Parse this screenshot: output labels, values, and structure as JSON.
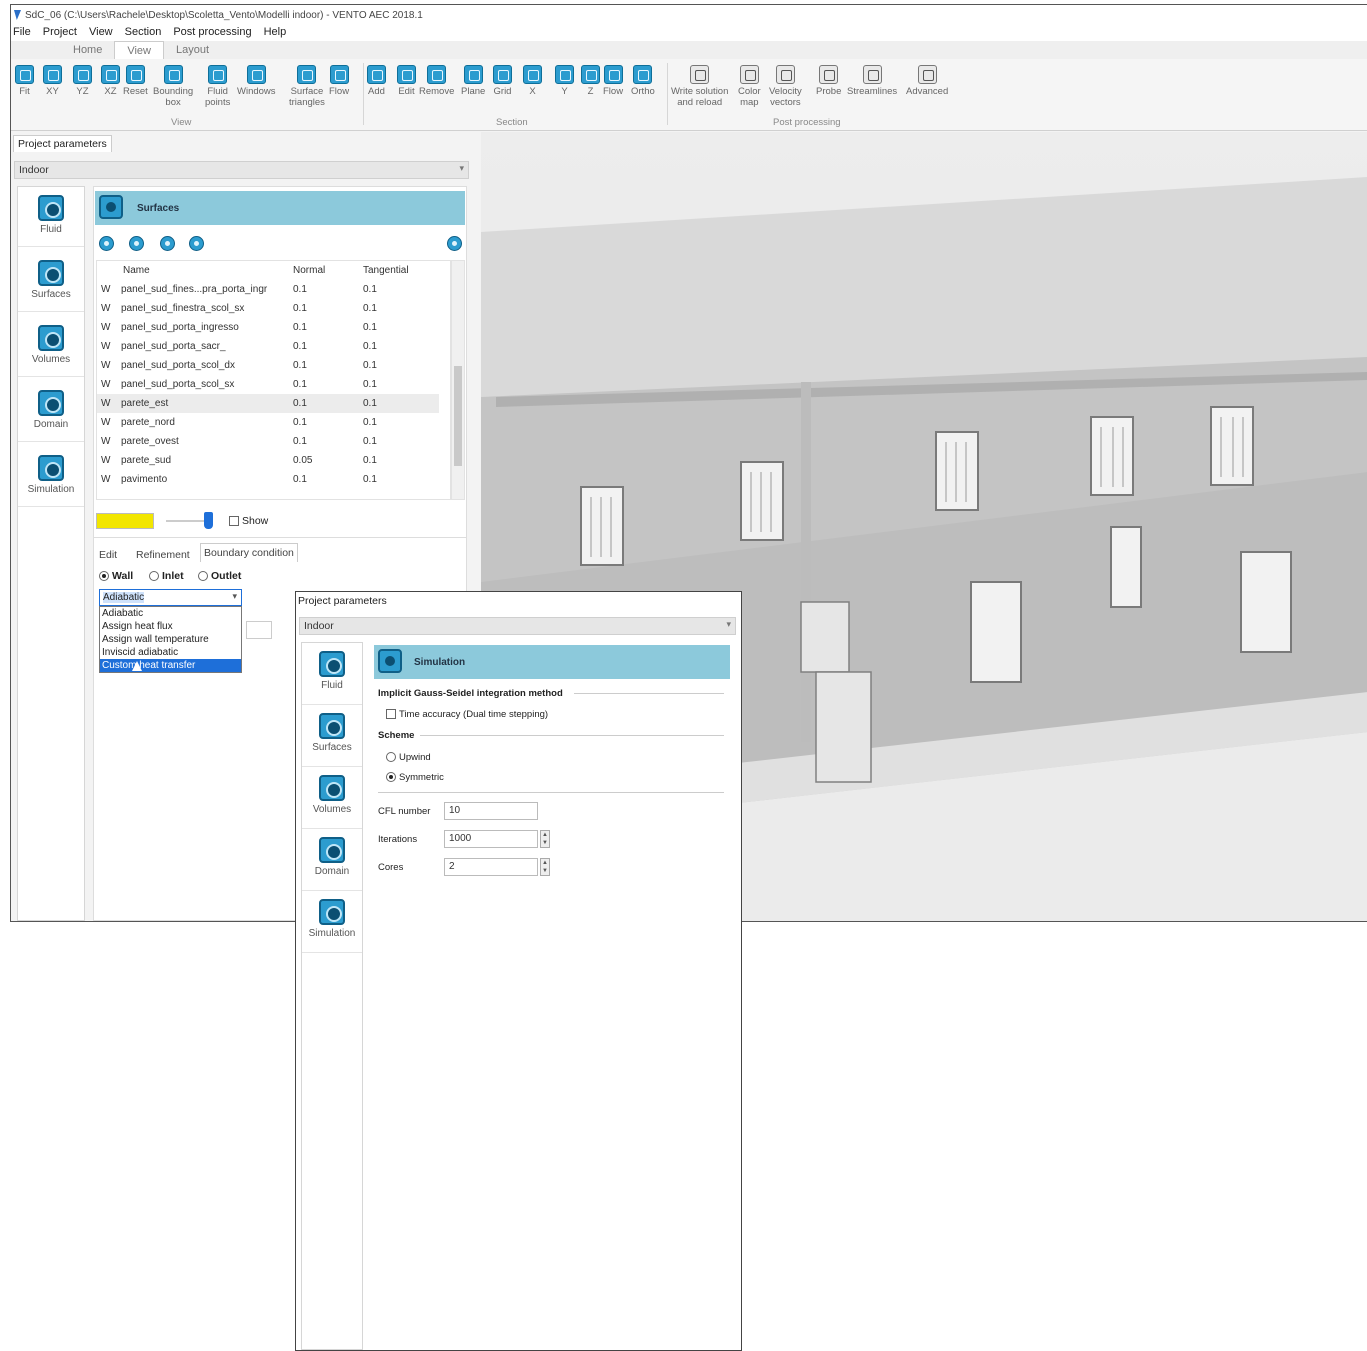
{
  "window": {
    "title": "SdC_06 (C:\\Users\\Rachele\\Desktop\\Scoletta_Vento\\Modelli indoor) - VENTO AEC 2018.1"
  },
  "menu": [
    "File",
    "Project",
    "View",
    "Section",
    "Post processing",
    "Help"
  ],
  "ribbon_tabs": [
    "Home",
    "View",
    "Layout"
  ],
  "ribbon": {
    "view_buttons": [
      {
        "l1": "Fit",
        "l2": ""
      },
      {
        "l1": "XY",
        "l2": ""
      },
      {
        "l1": "YZ",
        "l2": ""
      },
      {
        "l1": "XZ",
        "l2": ""
      },
      {
        "l1": "Reset",
        "l2": ""
      },
      {
        "l1": "Bounding",
        "l2": "box"
      },
      {
        "l1": "Fluid",
        "l2": "points"
      },
      {
        "l1": "Windows",
        "l2": ""
      },
      {
        "l1": "Surface",
        "l2": "triangles"
      },
      {
        "l1": "Flow",
        "l2": ""
      }
    ],
    "section_buttons": [
      {
        "l1": "Add",
        "l2": ""
      },
      {
        "l1": "Edit",
        "l2": ""
      },
      {
        "l1": "Remove",
        "l2": ""
      },
      {
        "l1": "Plane",
        "l2": ""
      },
      {
        "l1": "Grid",
        "l2": ""
      },
      {
        "l1": "X",
        "l2": ""
      },
      {
        "l1": "Y",
        "l2": ""
      },
      {
        "l1": "Z",
        "l2": ""
      },
      {
        "l1": "Flow",
        "l2": ""
      },
      {
        "l1": "Ortho",
        "l2": ""
      }
    ],
    "post_buttons": [
      {
        "l1": "Write solution",
        "l2": "and reload"
      },
      {
        "l1": "Color",
        "l2": "map"
      },
      {
        "l1": "Velocity",
        "l2": "vectors"
      },
      {
        "l1": "Probe",
        "l2": ""
      },
      {
        "l1": "Streamlines",
        "l2": ""
      },
      {
        "l1": "Advanced",
        "l2": ""
      }
    ],
    "groups": {
      "view": "View",
      "section": "Section",
      "post": "Post processing"
    }
  },
  "left_panel": {
    "tab": "Project parameters",
    "dropdown": "Indoor",
    "sidebar": [
      "Fluid",
      "Surfaces",
      "Volumes",
      "Domain",
      "Simulation"
    ],
    "header": "Surfaces",
    "table": {
      "columns": [
        "Name",
        "Normal",
        "Tangential"
      ],
      "rows": [
        {
          "t": "W",
          "name": "panel_sud_fines...pra_porta_ingr",
          "normal": "0.1",
          "tangential": "0.1"
        },
        {
          "t": "W",
          "name": "panel_sud_finestra_scol_sx",
          "normal": "0.1",
          "tangential": "0.1"
        },
        {
          "t": "W",
          "name": "panel_sud_porta_ingresso",
          "normal": "0.1",
          "tangential": "0.1"
        },
        {
          "t": "W",
          "name": "panel_sud_porta_sacr_",
          "normal": "0.1",
          "tangential": "0.1"
        },
        {
          "t": "W",
          "name": "panel_sud_porta_scol_dx",
          "normal": "0.1",
          "tangential": "0.1"
        },
        {
          "t": "W",
          "name": "panel_sud_porta_scol_sx",
          "normal": "0.1",
          "tangential": "0.1"
        },
        {
          "t": "W",
          "name": "parete_est",
          "normal": "0.1",
          "tangential": "0.1"
        },
        {
          "t": "W",
          "name": "parete_nord",
          "normal": "0.1",
          "tangential": "0.1"
        },
        {
          "t": "W",
          "name": "parete_ovest",
          "normal": "0.1",
          "tangential": "0.1"
        },
        {
          "t": "W",
          "name": "parete_sud",
          "normal": "0.05",
          "tangential": "0.1"
        },
        {
          "t": "W",
          "name": "pavimento",
          "normal": "0.1",
          "tangential": "0.1"
        }
      ]
    },
    "color_swatch": "#f2e600",
    "show_label": "Show",
    "subtabs": [
      "Edit",
      "Refinement",
      "Boundary condition"
    ],
    "bc_types": [
      "Wall",
      "Inlet",
      "Outlet"
    ],
    "bc_selected": "Adiabatic",
    "bc_options": [
      "Adiabatic",
      "Assign heat flux",
      "Assign wall temperature",
      "Inviscid adiabatic",
      "Custom heat transfer"
    ]
  },
  "popup": {
    "tab": "Project parameters",
    "dropdown": "Indoor",
    "sidebar": [
      "Fluid",
      "Surfaces",
      "Volumes",
      "Domain",
      "Simulation"
    ],
    "header": "Simulation",
    "method_label": "Implicit Gauss-Seidel integration method",
    "time_accuracy": "Time accuracy (Dual time stepping)",
    "scheme_label": "Scheme",
    "scheme_options": [
      "Upwind",
      "Symmetric"
    ],
    "cfl_label": "CFL number",
    "cfl_value": "10",
    "iter_label": "Iterations",
    "iter_value": "1000",
    "cores_label": "Cores",
    "cores_value": "2"
  },
  "colors": {
    "accent": "#2c9ccf",
    "header": "#8cc9db",
    "selection": "#1e6fd9"
  }
}
